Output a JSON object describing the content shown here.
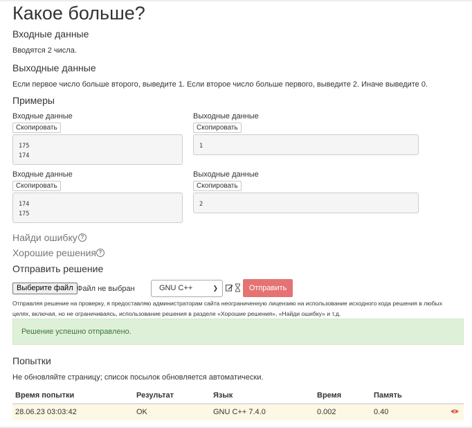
{
  "problem": {
    "title": "Какое больше?",
    "input_heading": "Входные данные",
    "input_text": "Вводятся 2 числа.",
    "output_heading": "Выходные данные",
    "output_text": "Если первое число больше второго, выведите 1. Если второе число больше первого, выведите 2. Иначе выведите 0.",
    "examples_heading": "Примеры"
  },
  "examples": [
    {
      "input_label": "Входные данные",
      "output_label": "Выходные данные",
      "copy_label": "Скопировать",
      "input": "175\n174",
      "output": "1"
    },
    {
      "input_label": "Входные данные",
      "output_label": "Выходные данные",
      "copy_label": "Скопировать",
      "input": "174\n175",
      "output": "2"
    }
  ],
  "links": {
    "find_error": "Найди ошибку",
    "good_solutions": "Хорошие решения"
  },
  "submit": {
    "heading": "Отправить решение",
    "choose_file": "Выберите файл",
    "no_file": "Файл не выбран",
    "language": "GNU C++",
    "send_button": "Отправить",
    "license_line1": "Отправляя решение на проверку, я предоставляю администраторам сайта неограниченную лицензию на использование исходного кода решения в любых",
    "license_line2": "целях, включая, но не ограничиваясь, использование решения в разделе «Хорошие решения», «Найди ошибку» и т.д.",
    "success": "Решение успешно отправлено."
  },
  "attempts": {
    "heading": "Попытки",
    "note": "Не обновляйте страницу; список посылок обновляется автоматически.",
    "columns": [
      "Время попытки",
      "Результат",
      "Язык",
      "Время",
      "Память"
    ],
    "rows": [
      {
        "time": "28.06.23 03:03:42",
        "result": "OK",
        "language": "GNU C++ 7.4.0",
        "runtime": "0.002",
        "memory": "0.40"
      }
    ]
  },
  "colors": {
    "send_button": "#e57373",
    "success_bg": "#dff0d8",
    "row_bg": "#fcf8e3",
    "eye": "#d9534f"
  }
}
